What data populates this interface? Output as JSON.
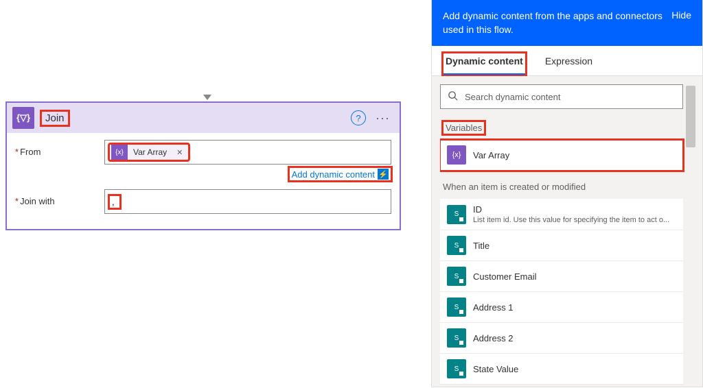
{
  "action": {
    "icon": "{▽}",
    "title": "Join",
    "from_label": "From",
    "joinwith_label": "Join with",
    "from_token": "Var Array",
    "joinwith_value": ",",
    "add_dynamic": "Add dynamic content"
  },
  "panel": {
    "banner_text": "Add dynamic content from the apps and connectors used in this flow.",
    "hide": "Hide",
    "tabs": {
      "dynamic": "Dynamic content",
      "expression": "Expression"
    },
    "search_placeholder": "Search dynamic content",
    "sections": {
      "variables": {
        "header": "Variables",
        "items": [
          {
            "title": "Var Array",
            "icon": "purple",
            "glyph": "{x}"
          }
        ]
      },
      "trigger": {
        "header": "When an item is created or modified",
        "items": [
          {
            "title": "ID",
            "desc": "List item id. Use this value for specifying the item to act o...",
            "icon": "teal",
            "glyph": "S"
          },
          {
            "title": "Title",
            "icon": "teal",
            "glyph": "S"
          },
          {
            "title": "Customer Email",
            "icon": "teal",
            "glyph": "S"
          },
          {
            "title": "Address 1",
            "icon": "teal",
            "glyph": "S"
          },
          {
            "title": "Address 2",
            "icon": "teal",
            "glyph": "S"
          },
          {
            "title": "State Value",
            "icon": "teal",
            "glyph": "S"
          }
        ]
      }
    }
  }
}
